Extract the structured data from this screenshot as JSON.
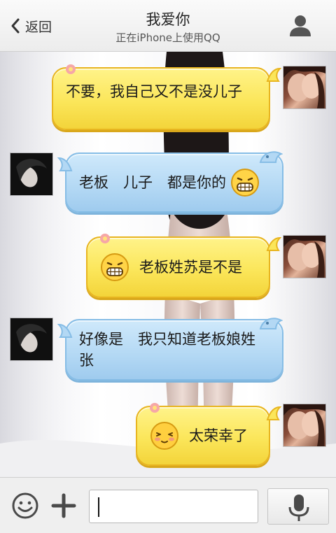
{
  "header": {
    "back_label": "返回",
    "title": "我爱你",
    "subtitle": "正在iPhone上使用QQ"
  },
  "messages": [
    {
      "side": "right",
      "color": "yellow",
      "text": "不要，我自己又不是没儿子"
    },
    {
      "side": "left",
      "color": "blue",
      "text": "老板　儿子　都是你的",
      "emoji": "grin-emoji"
    },
    {
      "side": "right",
      "color": "yellow",
      "text": "老板姓苏是不是",
      "emoji": "grin-emoji"
    },
    {
      "side": "left",
      "color": "blue",
      "text": "好像是　我只知道老板娘姓张"
    },
    {
      "side": "right",
      "color": "yellow",
      "text": "太荣幸了",
      "emoji": "shy-emoji"
    }
  ],
  "input": {
    "value": "",
    "placeholder": ""
  },
  "colors": {
    "yellow_bubble": "#fbe65a",
    "blue_bubble": "#b3d8f4",
    "header_bg": "#f5f5f5"
  },
  "icons": [
    "back-chevron-icon",
    "profile-icon",
    "emoji-icon",
    "plus-icon",
    "microphone-icon"
  ]
}
